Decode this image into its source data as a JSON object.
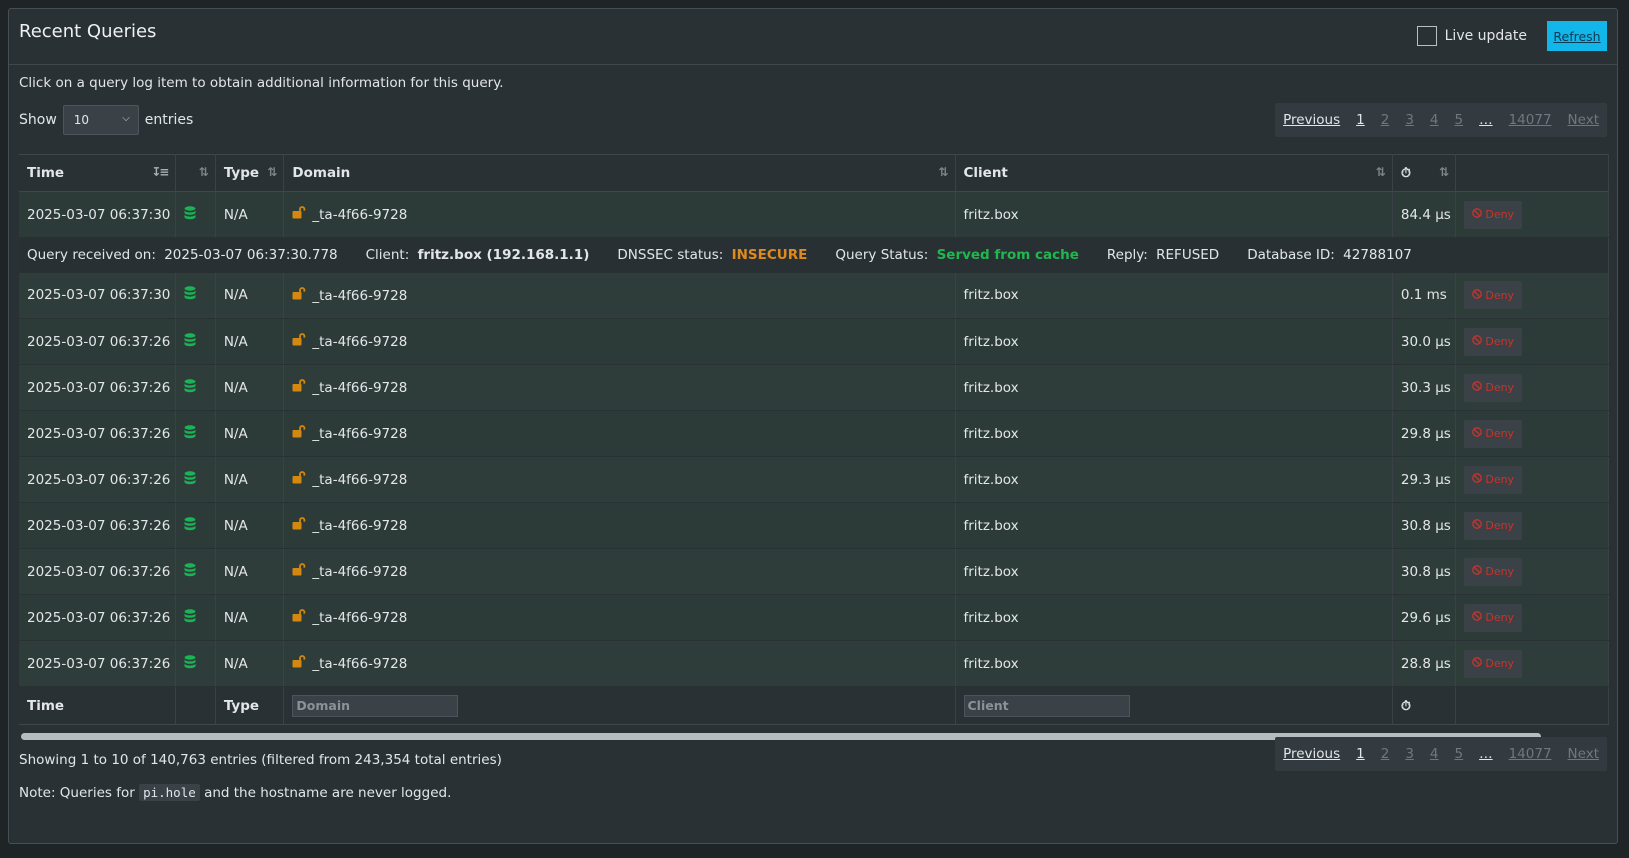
{
  "header": {
    "title": "Recent Queries",
    "live_update_label": "Live update",
    "refresh_label": "Refresh"
  },
  "hint": "Click on a query log item to obtain additional information for this query.",
  "length": {
    "show_label": "Show",
    "value": "10",
    "entries_label": "entries"
  },
  "pagination": {
    "previous": "Previous",
    "pages": [
      "1",
      "2",
      "3",
      "4",
      "5",
      "…",
      "14077"
    ],
    "next": "Next",
    "active": "1"
  },
  "table": {
    "headers": {
      "time": "Time",
      "type": "Type",
      "domain": "Domain",
      "client": "Client"
    },
    "rows": [
      {
        "time": "2025-03-07 06:37:30",
        "type": "N/A",
        "domain": "_ta-4f66-9728",
        "client": "fritz.box",
        "reply_time": "84.4 µs",
        "action": "Deny"
      },
      {
        "time": "2025-03-07 06:37:30",
        "type": "N/A",
        "domain": "_ta-4f66-9728",
        "client": "fritz.box",
        "reply_time": "0.1 ms",
        "action": "Deny"
      },
      {
        "time": "2025-03-07 06:37:26",
        "type": "N/A",
        "domain": "_ta-4f66-9728",
        "client": "fritz.box",
        "reply_time": "30.0 µs",
        "action": "Deny"
      },
      {
        "time": "2025-03-07 06:37:26",
        "type": "N/A",
        "domain": "_ta-4f66-9728",
        "client": "fritz.box",
        "reply_time": "30.3 µs",
        "action": "Deny"
      },
      {
        "time": "2025-03-07 06:37:26",
        "type": "N/A",
        "domain": "_ta-4f66-9728",
        "client": "fritz.box",
        "reply_time": "29.8 µs",
        "action": "Deny"
      },
      {
        "time": "2025-03-07 06:37:26",
        "type": "N/A",
        "domain": "_ta-4f66-9728",
        "client": "fritz.box",
        "reply_time": "29.3 µs",
        "action": "Deny"
      },
      {
        "time": "2025-03-07 06:37:26",
        "type": "N/A",
        "domain": "_ta-4f66-9728",
        "client": "fritz.box",
        "reply_time": "30.8 µs",
        "action": "Deny"
      },
      {
        "time": "2025-03-07 06:37:26",
        "type": "N/A",
        "domain": "_ta-4f66-9728",
        "client": "fritz.box",
        "reply_time": "30.8 µs",
        "action": "Deny"
      },
      {
        "time": "2025-03-07 06:37:26",
        "type": "N/A",
        "domain": "_ta-4f66-9728",
        "client": "fritz.box",
        "reply_time": "29.6 µs",
        "action": "Deny"
      },
      {
        "time": "2025-03-07 06:37:26",
        "type": "N/A",
        "domain": "_ta-4f66-9728",
        "client": "fritz.box",
        "reply_time": "28.8 µs",
        "action": "Deny"
      }
    ],
    "detail": {
      "received_label": "Query received on:",
      "received_value": "2025-03-07 06:37:30.778",
      "client_label": "Client:",
      "client_value": "fritz.box (192.168.1.1)",
      "dnssec_label": "DNSSEC status:",
      "dnssec_value": "INSECURE",
      "status_label": "Query Status:",
      "status_value": "Served from cache",
      "reply_label": "Reply:",
      "reply_value": "REFUSED",
      "dbid_label": "Database ID:",
      "dbid_value": "42788107"
    },
    "footer": {
      "time": "Time",
      "type": "Type",
      "domain_placeholder": "Domain",
      "client_placeholder": "Client"
    }
  },
  "summary": "Showing 1 to 10 of 140,763 entries (filtered from 243,354 total entries)",
  "note": {
    "prefix": "Note: Queries for",
    "code": "pi.hole",
    "suffix": "and the hostname are never logged."
  },
  "colors": {
    "accent": "#13b6e8",
    "db_icon": "#19b456",
    "lock_icon": "#d4880f",
    "deny": "#c9332b",
    "insecure": "#e08a1e",
    "cache": "#1fb74e"
  }
}
